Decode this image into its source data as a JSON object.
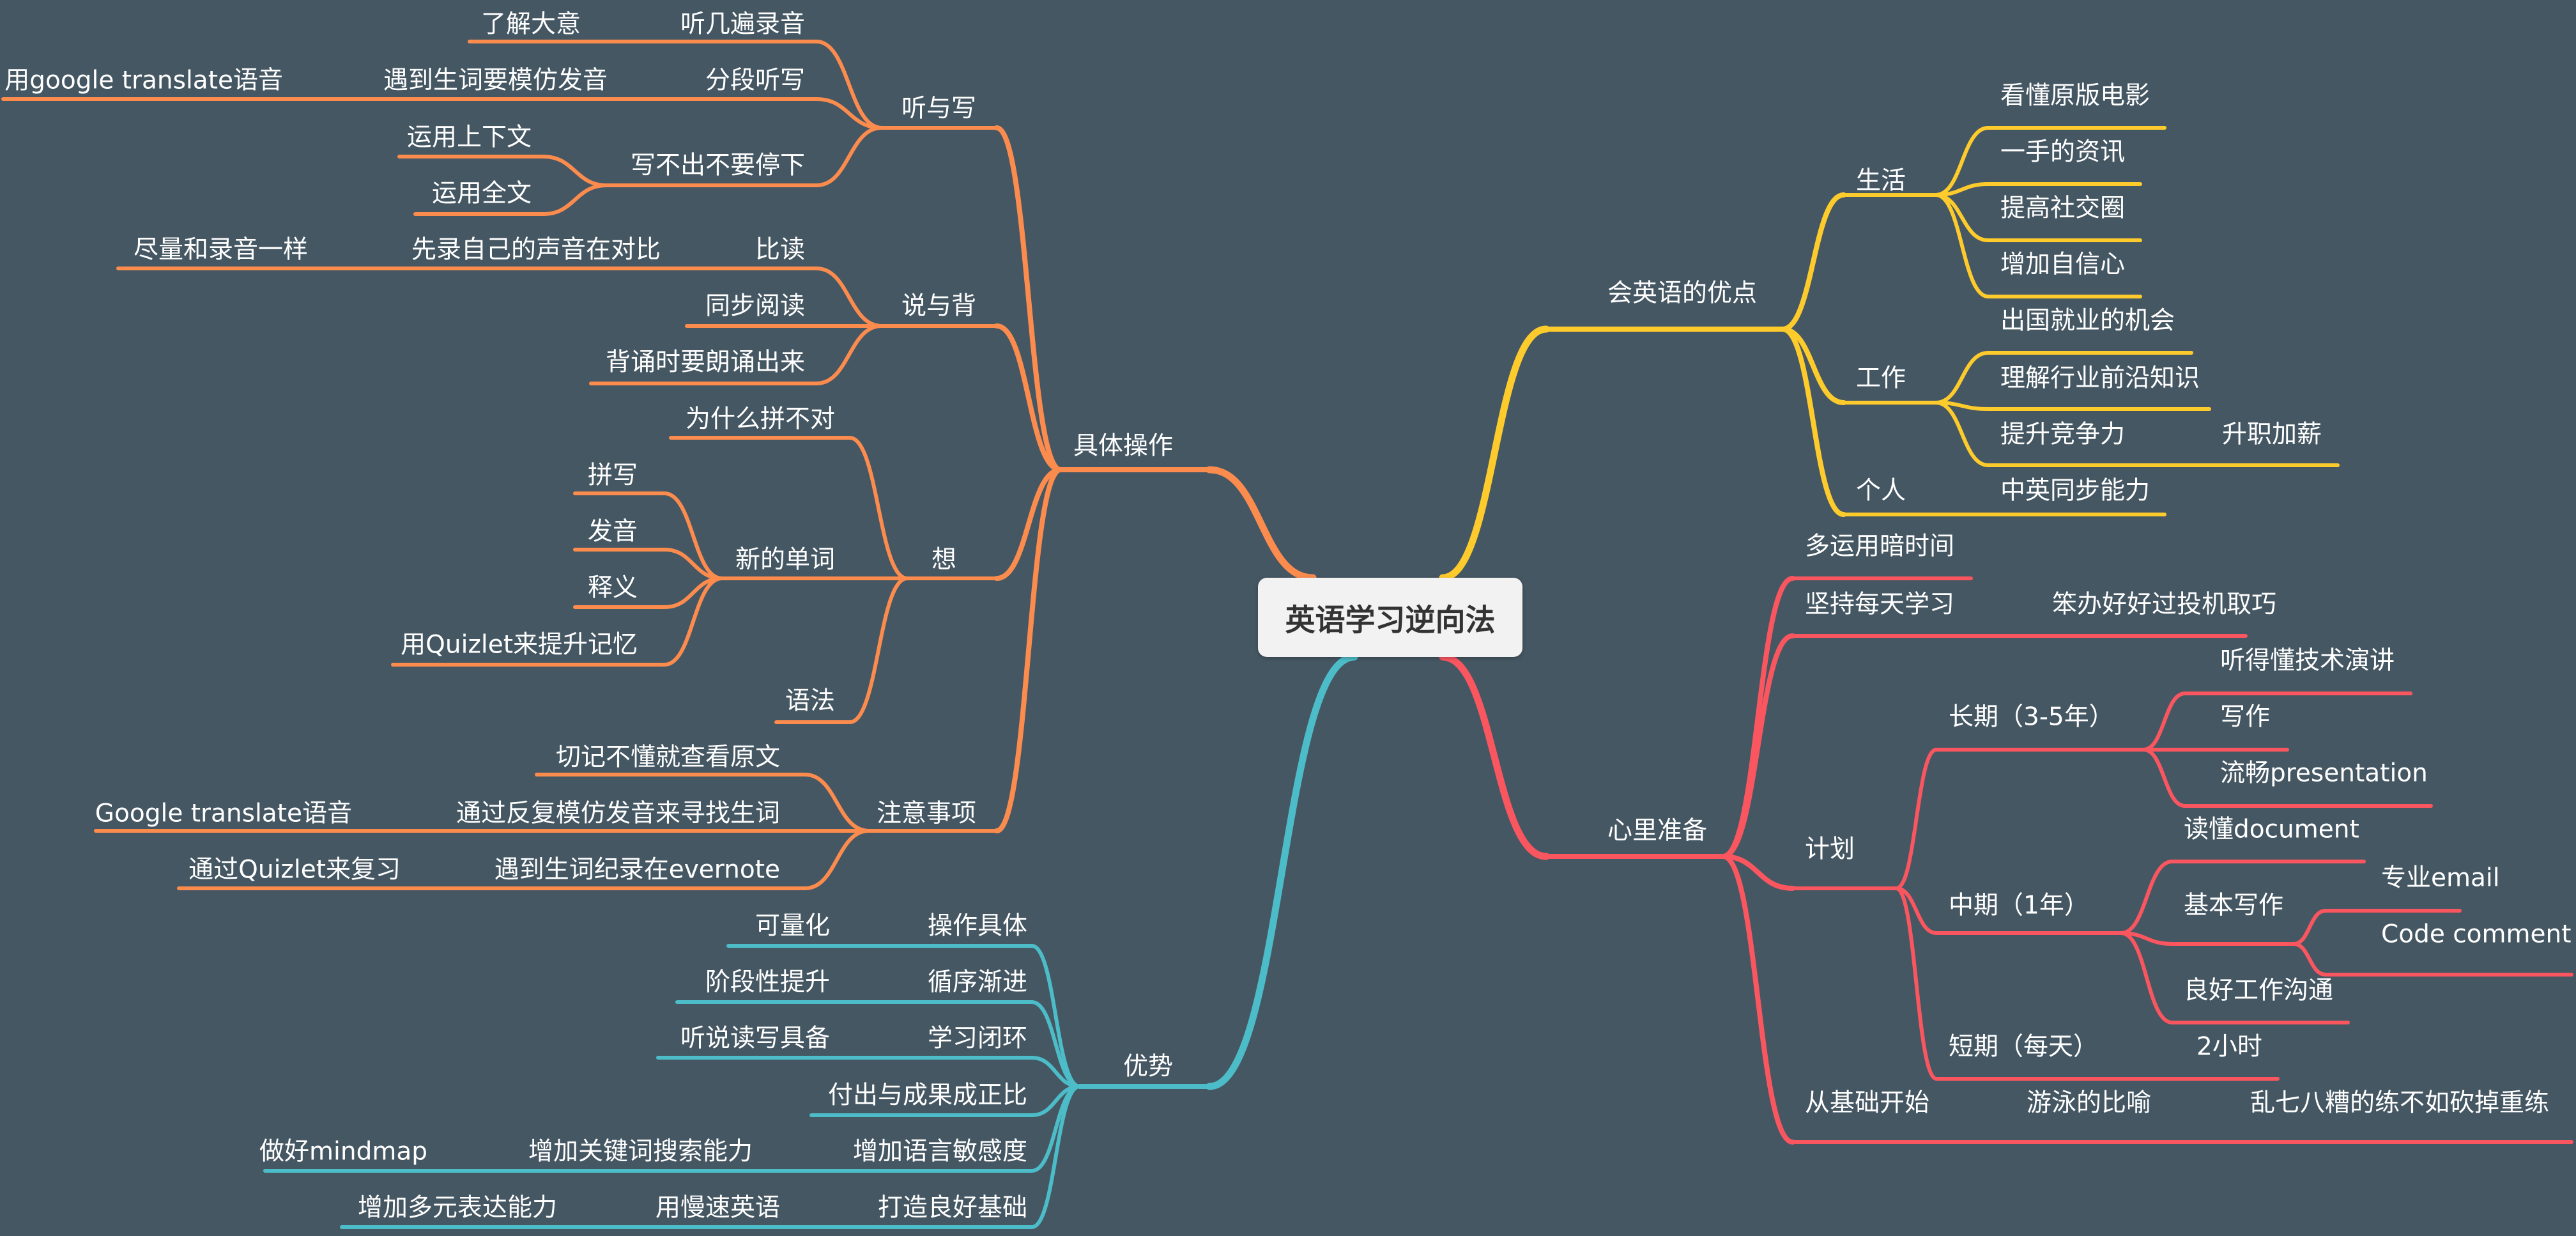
{
  "root": "英语学习逆向法",
  "colors": {
    "background": "#455763",
    "advantages_branch": "#fecb2d",
    "operations_branch": "#fc8b4e",
    "mindset_branch": "#f95660",
    "strengths_branch": "#4cbdc8"
  },
  "branches": {
    "advantages": {
      "label": "会英语的优点",
      "life": {
        "label": "生活",
        "items": [
          "看懂原版电影",
          "一手的资讯",
          "提高社交圈",
          "增加自信心"
        ]
      },
      "work": {
        "label": "工作",
        "items": [
          "出国就业的机会",
          "理解行业前沿知识",
          "提升竞争力"
        ],
        "promotion": "升职加薪"
      },
      "personal": {
        "label": "个人",
        "item": "中英同步能力"
      }
    },
    "mindset": {
      "label": "心里准备",
      "spare_time": "多运用暗时间",
      "daily": {
        "label": "坚持每天学习",
        "item": "笨办好好过投机取巧"
      },
      "plan": {
        "label": "计划",
        "long": {
          "label": "长期（3-5年）",
          "items": [
            "听得懂技术演讲",
            "写作",
            "流畅presentation"
          ]
        },
        "mid": {
          "label": "中期（1年）",
          "read": "读懂document",
          "writing": {
            "label": "基本写作",
            "items": [
              "专业email",
              "Code comment"
            ]
          },
          "communication": "良好工作沟通"
        },
        "short": {
          "label": "短期（每天）",
          "item": "2小时"
        }
      },
      "basics": {
        "label": "从基础开始",
        "metaphor": "游泳的比喻",
        "point": "乱七八糟的练不如砍掉重练"
      }
    },
    "operations": {
      "label": "具体操作",
      "listen_write": {
        "label": "听与写",
        "listen": {
          "label": "听几遍录音",
          "item": "了解大意"
        },
        "dictation": {
          "label": "分段听写",
          "mimic": "遇到生词要模仿发音",
          "tool": "用google translate语音"
        },
        "no_stop": {
          "label": "写不出不要停下",
          "items": [
            "运用上下文",
            "运用全文"
          ]
        }
      },
      "speak_recite": {
        "label": "说与背",
        "compare": {
          "label": "比读",
          "record": "先录自己的声音在对比",
          "match": "尽量和录音一样"
        },
        "sync": "同步阅读",
        "aloud": "背诵时要朗诵出来"
      },
      "think": {
        "label": "想",
        "why": "为什么拼不对",
        "new_words": {
          "label": "新的单词",
          "items": [
            "拼写",
            "发音",
            "释义",
            "用Quizlet来提升记忆"
          ]
        },
        "grammar": "语法"
      },
      "notes": {
        "label": "注意事项",
        "original": "切记不懂就查看原文",
        "imitate": {
          "label": "通过反复模仿发音来寻找生词",
          "tool": "Google translate语音"
        },
        "evernote": {
          "label": "遇到生词纪录在evernote",
          "review": "通过Quizlet来复习"
        }
      }
    },
    "strengths": {
      "label": "优势",
      "concrete": {
        "label": "操作具体",
        "item": "可量化"
      },
      "gradual": {
        "label": "循序渐进",
        "item": "阶段性提升"
      },
      "loop": {
        "label": "学习闭环",
        "item": "听说读写具备"
      },
      "payoff": "付出与成果成正比",
      "sensitivity": {
        "label": "增加语言敏感度",
        "keyword": "增加关键词搜索能力",
        "mindmap": "做好mindmap"
      },
      "foundation": {
        "label": "打造良好基础",
        "slow": "用慢速英语",
        "expression": "增加多元表达能力"
      }
    }
  }
}
